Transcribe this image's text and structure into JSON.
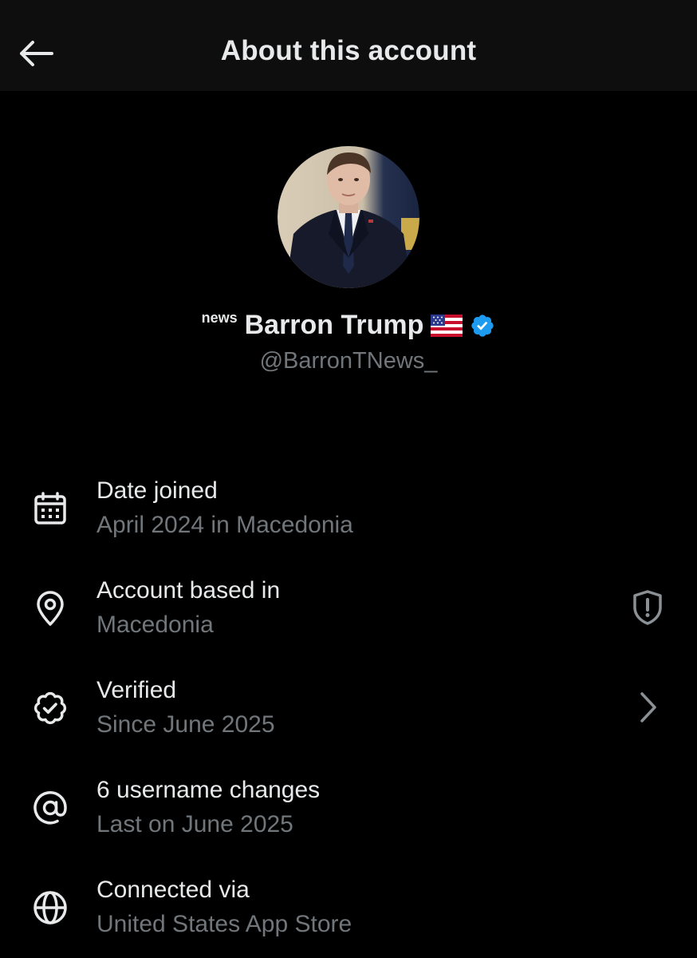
{
  "header": {
    "title": "About this account",
    "back_icon": "arrow-left-icon"
  },
  "profile": {
    "name_prefix": "news",
    "display_name": "Barron Trump",
    "flag_icon": "us-flag-icon",
    "verified_icon": "verified-badge-icon",
    "verified_color": "#1d9bf0",
    "handle": "@BarronTNews_"
  },
  "rows": [
    {
      "icon": "calendar-icon",
      "title": "Date joined",
      "subtitle": "April 2024 in Macedonia"
    },
    {
      "icon": "location-pin-icon",
      "title": "Account based in",
      "subtitle": "Macedonia",
      "trailing_icon": "shield-alert-icon"
    },
    {
      "icon": "verified-seal-icon",
      "title": "Verified",
      "subtitle": "Since June 2025",
      "trailing_icon": "chevron-right-icon"
    },
    {
      "icon": "at-sign-icon",
      "title": "6 username changes",
      "subtitle": "Last on June 2025"
    },
    {
      "icon": "globe-icon",
      "title": "Connected via",
      "subtitle": "United States App Store"
    }
  ],
  "colors": {
    "background": "#000000",
    "header_background": "#0e0e0e",
    "primary_text": "#e7e9ea",
    "secondary_text": "#71767b"
  }
}
